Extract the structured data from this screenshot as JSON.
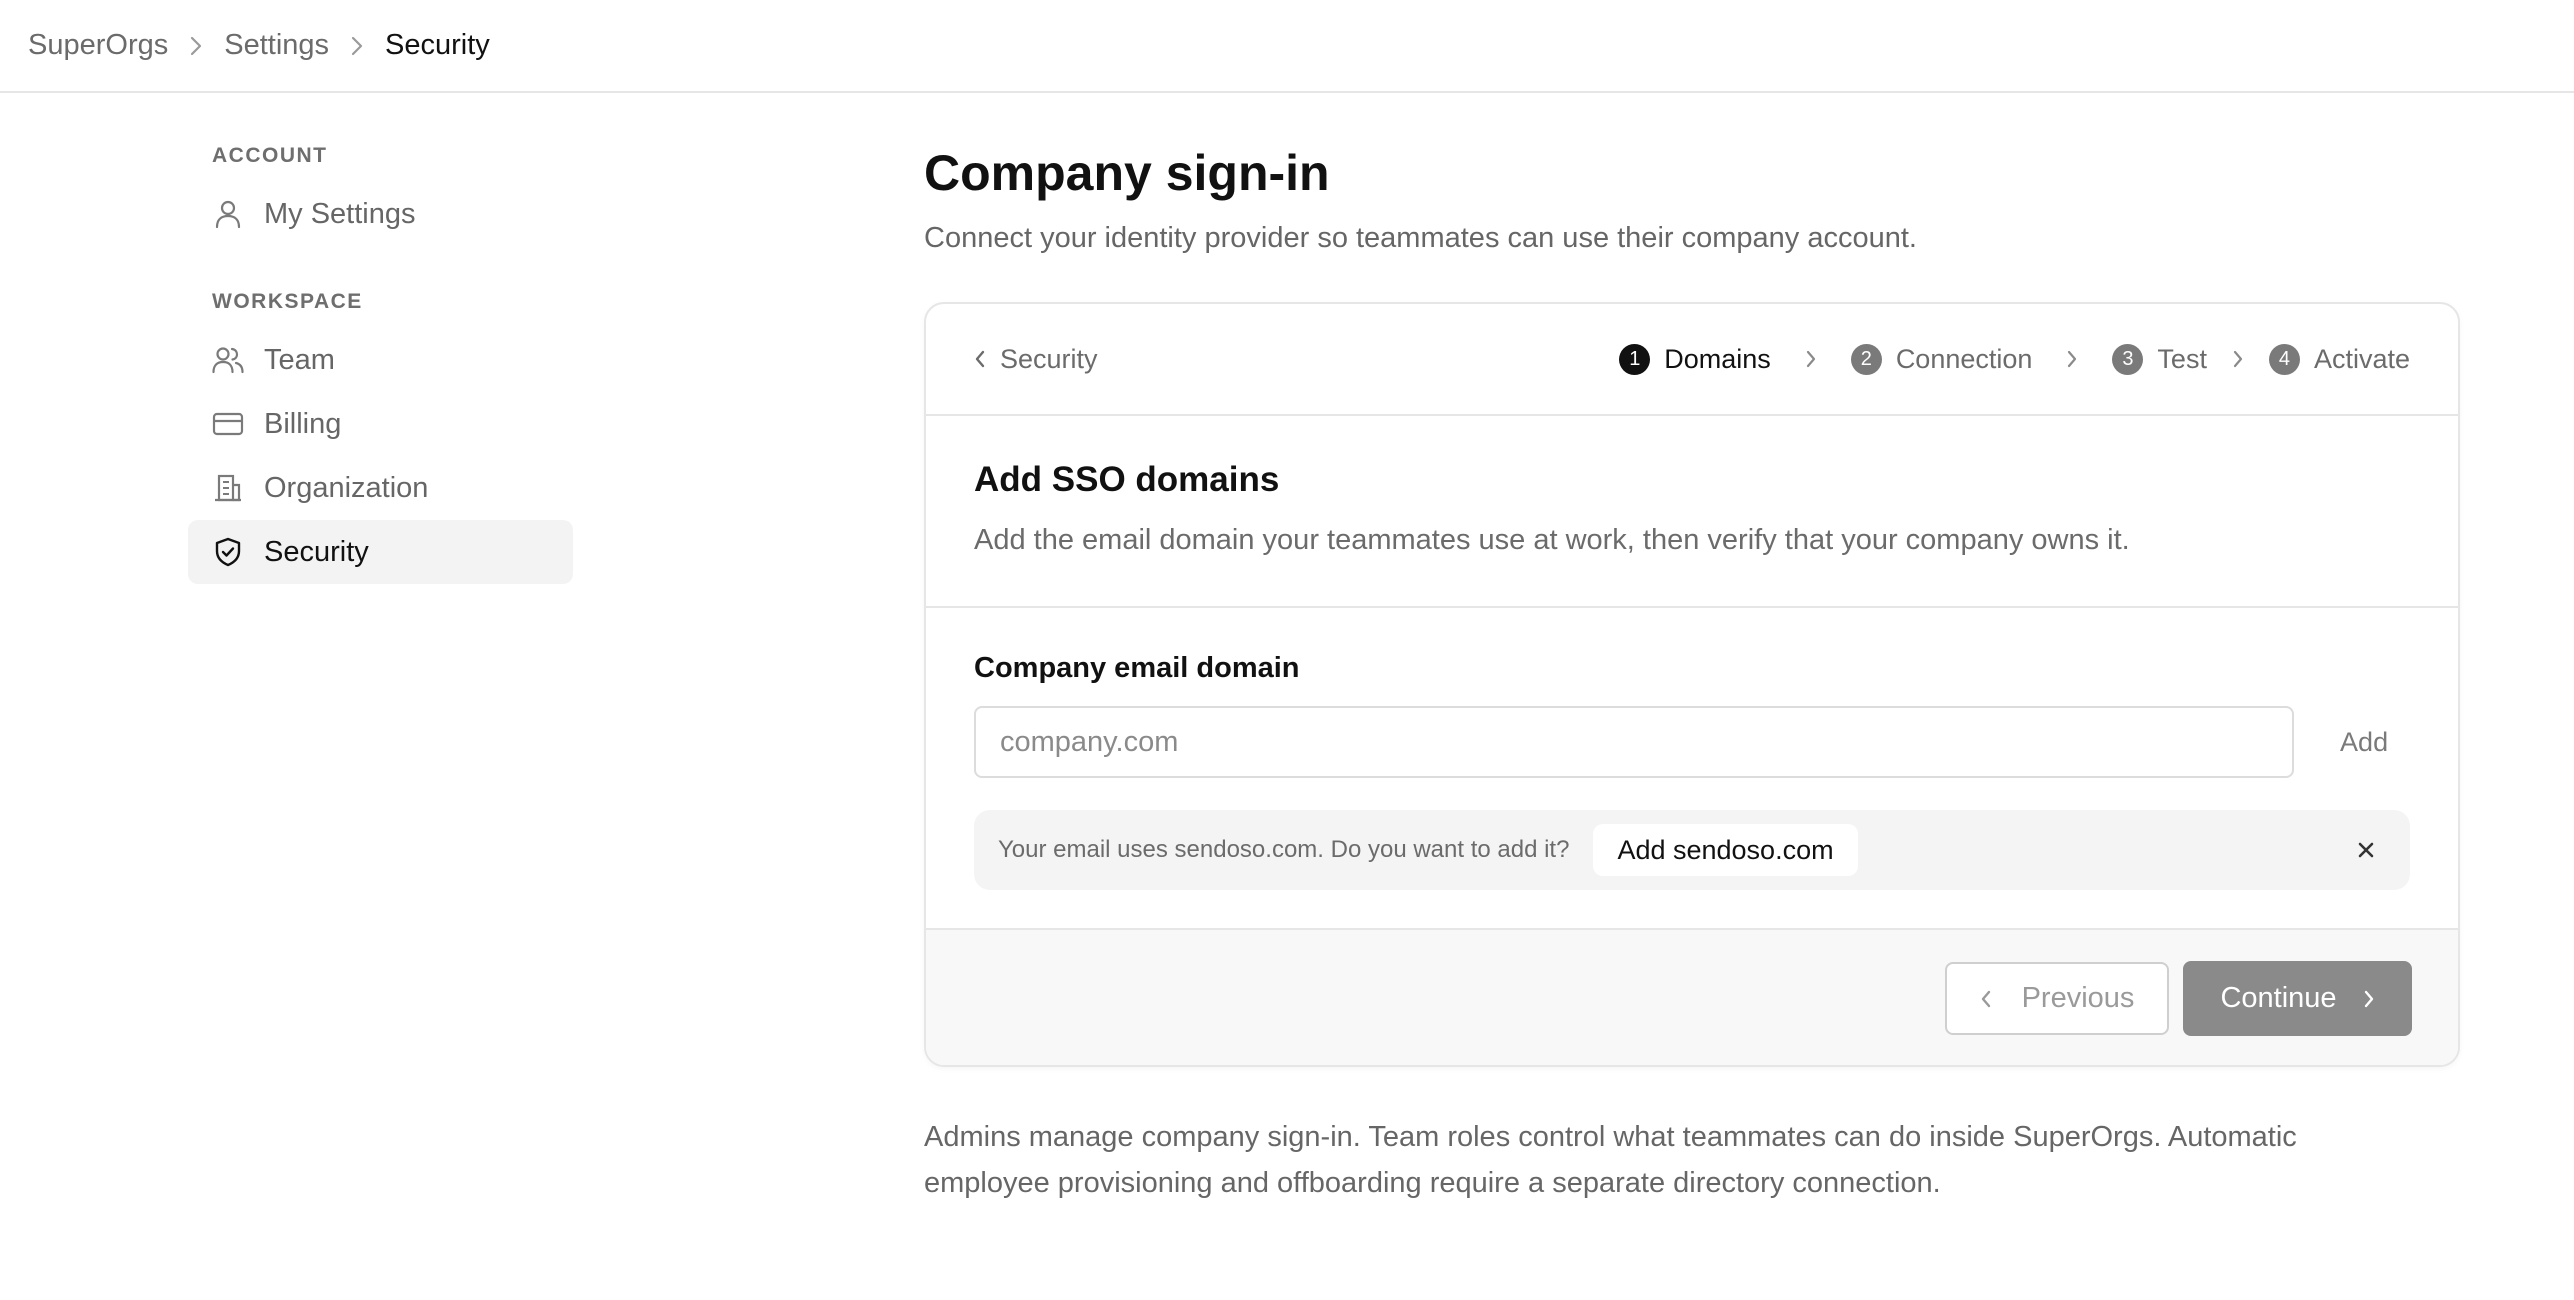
{
  "breadcrumb": {
    "items": [
      "SuperOrgs",
      "Settings",
      "Security"
    ]
  },
  "sidebar": {
    "sections": [
      {
        "label": "ACCOUNT",
        "items": [
          {
            "label": "My Settings",
            "icon": "user-icon"
          }
        ]
      },
      {
        "label": "WORKSPACE",
        "items": [
          {
            "label": "Team",
            "icon": "users-icon"
          },
          {
            "label": "Billing",
            "icon": "credit-card-icon"
          },
          {
            "label": "Organization",
            "icon": "building-icon"
          },
          {
            "label": "Security",
            "icon": "shield-check-icon",
            "active": true
          }
        ]
      }
    ]
  },
  "main": {
    "title": "Company sign-in",
    "subtitle": "Connect your identity provider so teammates can use their company account."
  },
  "wizard": {
    "back_label": "Security",
    "steps": [
      {
        "number": "1",
        "label": "Domains",
        "active": true
      },
      {
        "number": "2",
        "label": "Connection"
      },
      {
        "number": "3",
        "label": "Test"
      },
      {
        "number": "4",
        "label": "Activate"
      }
    ],
    "section_title": "Add SSO domains",
    "section_desc": "Add the email domain your teammates use at work, then verify that your company owns it.",
    "field_label": "Company email domain",
    "input_value": "",
    "input_placeholder": "company.com",
    "add_label": "Add",
    "suggestion_text": "Your email uses sendoso.com. Do you want to add it?",
    "suggestion_button": "Add sendoso.com",
    "previous_label": "Previous",
    "continue_label": "Continue"
  },
  "footnote": "Admins manage company sign-in. Team roles control what teammates can do inside SuperOrgs. Automatic employee provisioning and offboarding require a separate directory connection.",
  "colors": {
    "text_primary": "#111111",
    "text_muted": "#6b6b6b",
    "border": "#e6e6e6",
    "active_bg": "#f3f3f3",
    "continue_bg": "#8a8a8a"
  }
}
